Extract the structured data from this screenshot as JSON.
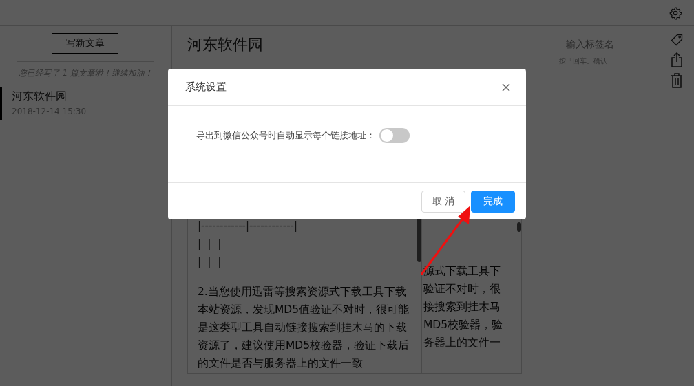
{
  "sidebar": {
    "new_button": "写新文章",
    "summary": "您已经写了 1 篇文章啦！继续加油！",
    "articles": [
      {
        "title": "河东软件园",
        "date": "2018-12-14 15:30",
        "selected": true
      }
    ]
  },
  "article": {
    "title": "河东软件园",
    "tag_field": {
      "placeholder": "输入标签名",
      "hint": "按「回车」确认"
    }
  },
  "editor": {
    "source_lines": [
      "|------------|------------|",
      "|  |  |",
      "|  |  |"
    ],
    "source_paragraph": "2.当您使用迅雷等搜索资源式下载工具下载本站资源，发现MD5值验证不对时，很可能是这类型工具自动链接搜索到挂木马的下载资源了，建议使用MD5校验器，验证下载后的文件是否与服务器上的文件一致",
    "preview_lines": [
      "源式下载工具下",
      "验证不对时，很",
      "接搜索到挂木马",
      "MD5校验器，验",
      "务器上的文件一"
    ]
  },
  "dialog": {
    "title": "系统设置",
    "settings": [
      {
        "label": "导出到微信公众号时自动显示每个链接地址：",
        "on": false
      }
    ],
    "buttons": [
      {
        "label": "取 消",
        "kind": "secondary"
      },
      {
        "label": "完成",
        "kind": "primary"
      }
    ]
  }
}
